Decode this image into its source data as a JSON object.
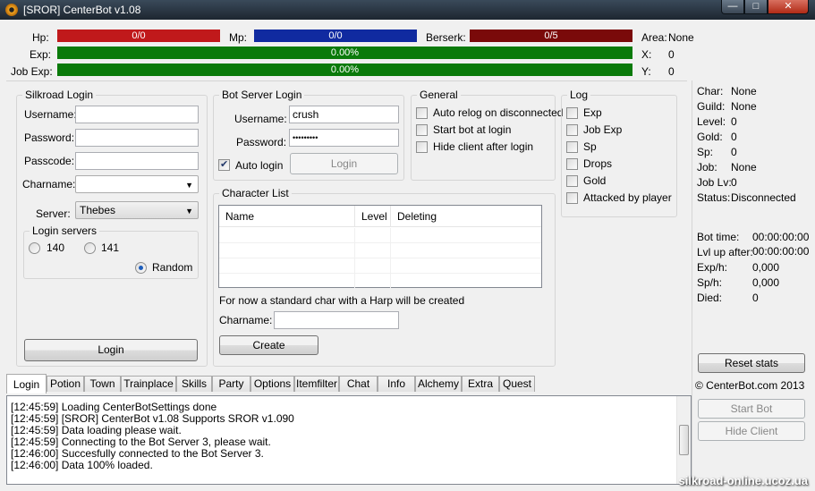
{
  "window": {
    "title": "[SROR] CenterBot v1.08",
    "min_glyph": "—",
    "max_glyph": "□",
    "close_glyph": "✕"
  },
  "stats_bar": {
    "hp_label": "Hp:",
    "hp_value": "0/0",
    "mp_label": "Mp:",
    "mp_value": "0/0",
    "berserk_label": "Berserk:",
    "berserk_value": "0/5",
    "exp_label": "Exp:",
    "exp_value": "0.00%",
    "jobexp_label": "Job Exp:",
    "jobexp_value": "0.00%",
    "area_label": "Area:",
    "area_value": "None",
    "x_label": "X:",
    "x_value": "0",
    "y_label": "Y:",
    "y_value": "0",
    "colors": {
      "hp": "#c0191b",
      "mp": "#102aa0",
      "berserk": "#7a0a0a",
      "exp": "#0a7a0a"
    }
  },
  "silkroad_login": {
    "title": "Silkroad Login",
    "username_label": "Username:",
    "username_value": "",
    "password_label": "Password:",
    "password_value": "",
    "passcode_label": "Passcode:",
    "passcode_value": "",
    "charname_label": "Charname:",
    "charname_value": "",
    "server_label": "Server:",
    "server_value": "Thebes",
    "login_servers_title": "Login servers",
    "servers": [
      "140",
      "141",
      "Random"
    ],
    "selected_server": "Random",
    "login_button": "Login"
  },
  "bot_server_login": {
    "title": "Bot Server Login",
    "username_label": "Username:",
    "username_value": "crush",
    "password_label": "Password:",
    "password_value": "•••••••••",
    "auto_login_label": "Auto login",
    "auto_login_checked": true,
    "login_button": "Login"
  },
  "general": {
    "title": "General",
    "options": [
      {
        "label": "Auto relog on disconnected",
        "checked": false
      },
      {
        "label": "Start bot at login",
        "checked": false
      },
      {
        "label": "Hide client after login",
        "checked": false
      }
    ]
  },
  "log_options": {
    "title": "Log",
    "options": [
      {
        "label": "Exp",
        "checked": false
      },
      {
        "label": "Job Exp",
        "checked": false
      },
      {
        "label": "Sp",
        "checked": false
      },
      {
        "label": "Drops",
        "checked": false
      },
      {
        "label": "Gold",
        "checked": false
      },
      {
        "label": "Attacked by player",
        "checked": false
      }
    ]
  },
  "character_list": {
    "title": "Character List",
    "columns": [
      "Name",
      "Level",
      "Deleting"
    ],
    "rows": [],
    "hint": "For now a standard char with a Harp will be created",
    "charname_label": "Charname:",
    "charname_value": "",
    "create_button": "Create"
  },
  "char_info": {
    "char_label": "Char:",
    "char_value": "None",
    "guild_label": "Guild:",
    "guild_value": "None",
    "level_label": "Level:",
    "level_value": "0",
    "gold_label": "Gold:",
    "gold_value": "0",
    "sp_label": "Sp:",
    "sp_value": "0",
    "job_label": "Job:",
    "job_value": "None",
    "joblv_label": "Job Lv:",
    "joblv_value": "0",
    "status_label": "Status:",
    "status_value": "Disconnected"
  },
  "bot_stats": {
    "bottime_label": "Bot time:",
    "bottime_value": "00:00:00:00",
    "lvlup_label": "Lvl up after:",
    "lvlup_value": "00:00:00:00",
    "exph_label": "Exp/h:",
    "exph_value": "0,000",
    "sph_label": "Sp/h:",
    "sph_value": "0,000",
    "died_label": "Died:",
    "died_value": "0",
    "reset_button": "Reset stats",
    "copyright": "© CenterBot.com 2013",
    "start_bot_button": "Start Bot",
    "hide_client_button": "Hide Client"
  },
  "tabs": [
    "Login",
    "Potion",
    "Town",
    "Trainplace",
    "Skills",
    "Party",
    "Options",
    "Itemfilter",
    "Chat",
    "Info",
    "Alchemy",
    "Extra",
    "Quest"
  ],
  "active_tab": "Login",
  "log_lines": [
    "[12:45:59] Loading CenterBotSettings done",
    "[12:45:59] [SROR] CenterBot v1.08 Supports SROR v1.090",
    "[12:45:59] Data loading please wait.",
    "[12:45:59] Connecting to the Bot Server 3, please wait.",
    "[12:46:00] Succesfully connected to the Bot Server 3.",
    "[12:46:00] Data 100% loaded."
  ],
  "watermark": "silkroad-online.ucoz.ua"
}
